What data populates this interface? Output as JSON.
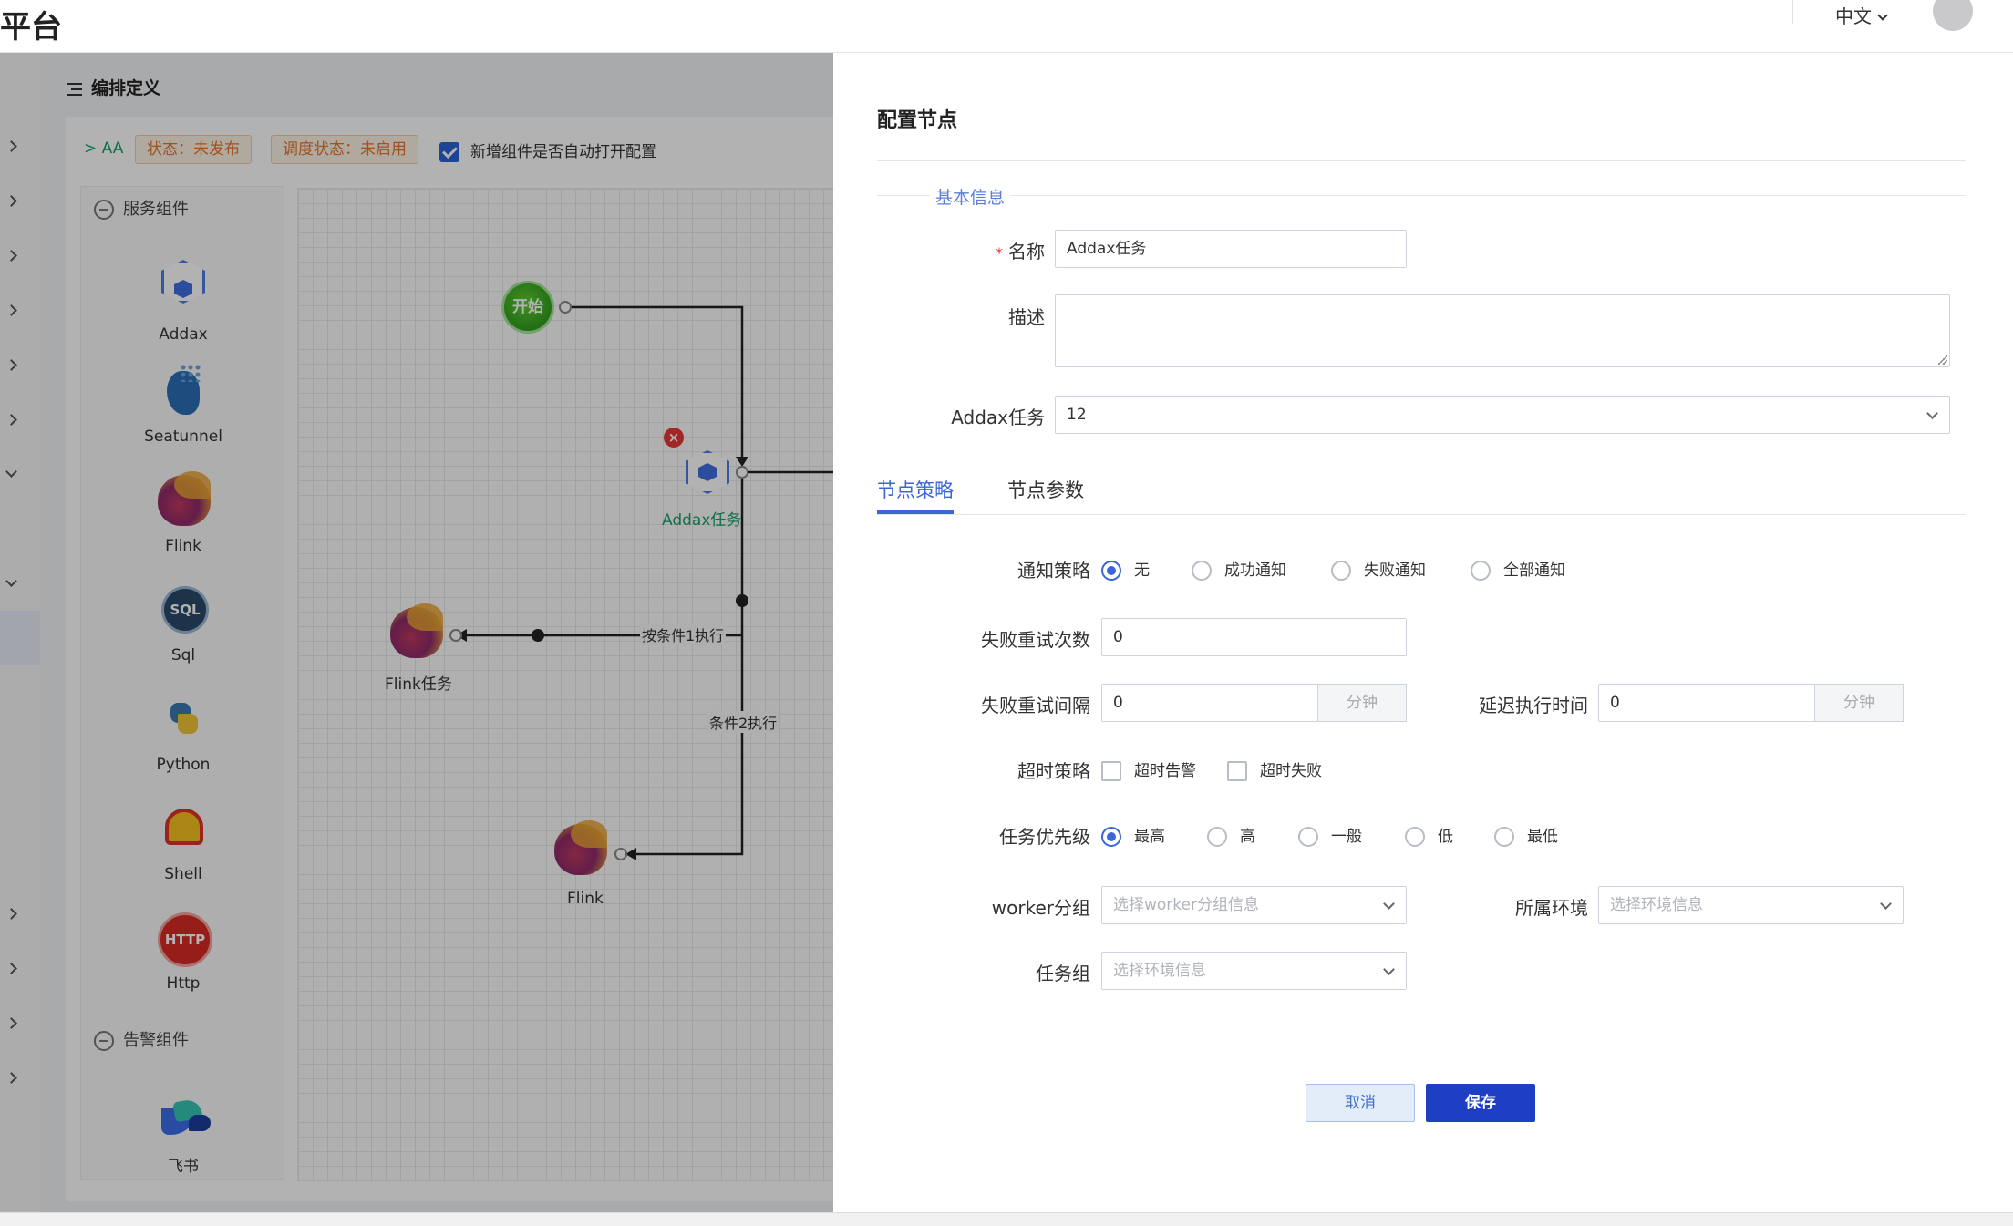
{
  "header": {
    "title": "平台",
    "lang": "中文"
  },
  "page": {
    "title": "编排定义",
    "crumb": "AA",
    "status_tag": "状态：未发布",
    "schedule_tag": "调度状态：未启用",
    "auto_open_label": "新增组件是否自动打开配置",
    "auto_open_checked": true
  },
  "palette": {
    "service_group": "服务组件",
    "alert_group": "告警组件",
    "components": [
      "Addax",
      "Seatunnel",
      "Flink",
      "Sql",
      "Python",
      "Shell",
      "Http"
    ],
    "alert_components": [
      "飞书"
    ]
  },
  "canvas": {
    "start_node": "开始",
    "addax_node": "Addax任务",
    "flink_task_node": "Flink任务",
    "flink_node": "Flink",
    "edge1_label": "按条件1执行",
    "edge2_label": "条件2执行"
  },
  "drawer": {
    "title": "配置节点",
    "section_basic": "基本信息",
    "name_label": "名称",
    "name_value": "Addax任务",
    "desc_label": "描述",
    "addax_label": "Addax任务",
    "addax_value": "12",
    "tabs": [
      "节点策略",
      "节点参数"
    ],
    "notify_label": "通知策略",
    "notify_options": [
      "无",
      "成功通知",
      "失败通知",
      "全部通知"
    ],
    "notify_selected": "无",
    "retry_times_label": "失败重试次数",
    "retry_times_value": "0",
    "retry_interval_label": "失败重试间隔",
    "retry_interval_value": "0",
    "delay_label": "延迟执行时间",
    "delay_value": "0",
    "unit_minute": "分钟",
    "timeout_label": "超时策略",
    "timeout_options": [
      "超时告警",
      "超时失败"
    ],
    "priority_label": "任务优先级",
    "priority_options": [
      "最高",
      "高",
      "一般",
      "低",
      "最低"
    ],
    "priority_selected": "最高",
    "worker_label": "worker分组",
    "worker_placeholder": "选择worker分组信息",
    "env_label": "所属环境",
    "env_placeholder": "选择环境信息",
    "taskgroup_label": "任务组",
    "taskgroup_placeholder": "选择环境信息",
    "cancel": "取消",
    "save": "保存"
  },
  "colors": {
    "primary": "#3a66d6",
    "save_button": "#1e3fc3",
    "tag_orange": "#e6742c",
    "success_green": "#19a06a"
  }
}
